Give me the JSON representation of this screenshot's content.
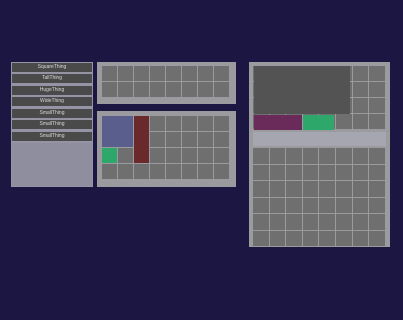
{
  "item_list": {
    "items": [
      {
        "label": "SquareThing"
      },
      {
        "label": "TallThing"
      },
      {
        "label": "HugeThing"
      },
      {
        "label": "WideThing"
      },
      {
        "label": "SmallThing"
      },
      {
        "label": "SmallThing"
      },
      {
        "label": "SmallThing"
      }
    ]
  },
  "grids": {
    "top": {
      "columns": 8,
      "rows": 2
    },
    "middle": {
      "columns": 8,
      "rows": 4
    },
    "right": {
      "columns": 8,
      "rows": 12
    }
  },
  "colors": {
    "background": "#1b1742",
    "panel": "#9b9b9f",
    "cell": "#6f6f6f",
    "list_button": "#4a4a4a",
    "square_item": "#5a5e8c",
    "tall_item": "#6a2a2c",
    "small_item": "#2ea86a",
    "huge_item": "#535353",
    "wide_item": "#6a2a5a"
  }
}
